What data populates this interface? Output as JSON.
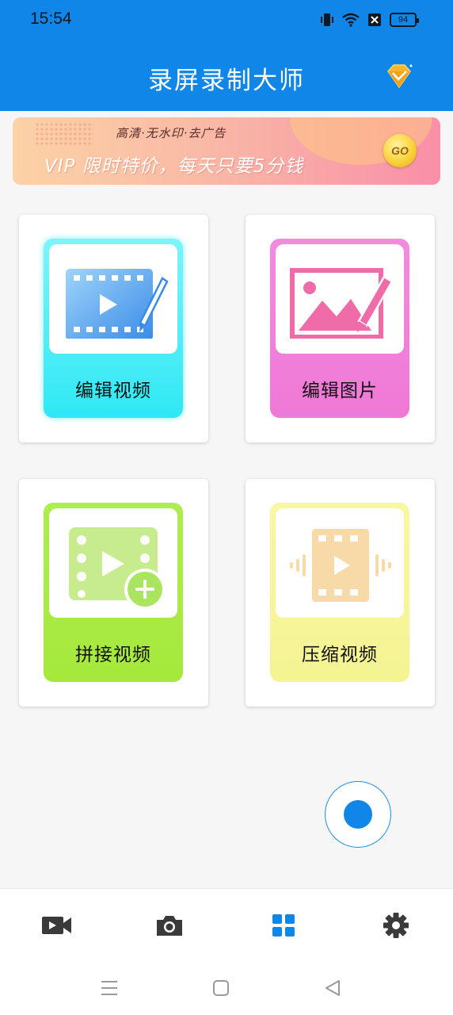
{
  "status_bar": {
    "time": "15:54",
    "battery": "94"
  },
  "header": {
    "title": "录屏录制大师",
    "vip_icon": "diamond-icon"
  },
  "banner": {
    "subtitle": "高清·无水印·去广告",
    "main_text": "VIP 限时特价，每天只要5分钱",
    "go_label": "GO"
  },
  "tools": [
    {
      "label": "编辑视频",
      "icon": "edit-video-icon",
      "color": "#2ee8f4"
    },
    {
      "label": "编辑图片",
      "icon": "edit-image-icon",
      "color": "#ef79d6"
    },
    {
      "label": "拼接视频",
      "icon": "merge-video-icon",
      "color": "#a6e93c"
    },
    {
      "label": "压缩视频",
      "icon": "compress-video-icon",
      "color": "#f5f492"
    }
  ],
  "bottom_nav": [
    {
      "name": "video-record",
      "icon": "video-camera-icon",
      "active": false
    },
    {
      "name": "screenshot",
      "icon": "camera-icon",
      "active": false
    },
    {
      "name": "tools",
      "icon": "grid-icon",
      "active": true
    },
    {
      "name": "settings",
      "icon": "gear-icon",
      "active": false
    }
  ],
  "colors": {
    "primary": "#0f86e8",
    "inactive_icon": "#3a3a3a"
  }
}
